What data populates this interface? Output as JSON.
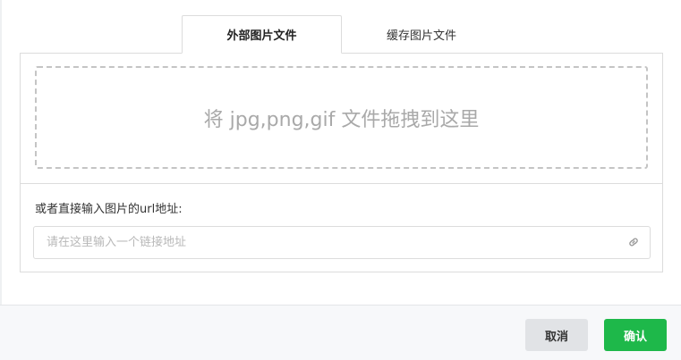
{
  "tabs": {
    "external": "外部图片文件",
    "cache": "缓存图片文件"
  },
  "dropzone": {
    "text": "将 jpg,png,gif 文件拖拽到这里"
  },
  "url": {
    "label": "或者直接输入图片的url地址:",
    "placeholder": "请在这里输入一个链接地址",
    "value": "",
    "icon": "link-icon"
  },
  "footer": {
    "cancel_label": "取消",
    "ok_label": "确认"
  },
  "colors": {
    "accent": "#1eb84a",
    "cancel_bg": "#e1e3e6"
  }
}
